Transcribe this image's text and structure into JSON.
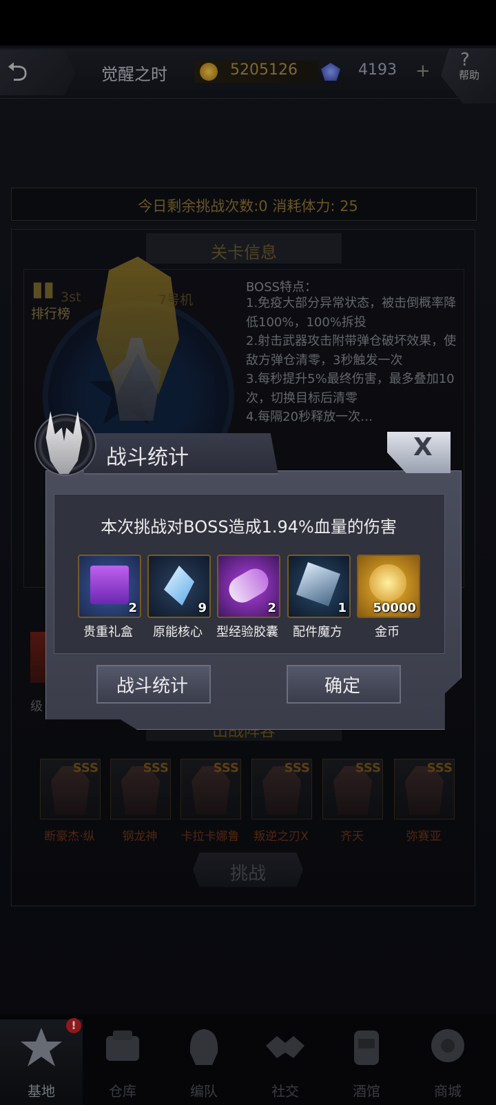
{
  "header": {
    "title": "觉醒之时",
    "coins": "5205126",
    "gems": "4193",
    "plus_label": "+",
    "help_label": "帮助",
    "help_symbol": "?"
  },
  "stage": {
    "attempts_text": "今日剩余挑战次数:0  消耗体力: 25",
    "panel_title": "关卡信息",
    "rank_label": "排行榜",
    "faint_left": "3st",
    "faint_right": "7号机",
    "boss_title": "BOSS特点：",
    "boss_features": [
      "1.免疫大部分异常状态，被击倒概率降低100%，100%拆投",
      "2.射击武器攻击附带弹仓破坏效果，使敌方弹仓清零，3秒触发一次",
      "3.每秒提升5%最终伤害，最多叠加10次，切换目标后清零",
      "4.每隔20秒释放一次…"
    ],
    "left_label": "级",
    "lineup_title": "出战阵容",
    "units": [
      {
        "name": "断豪杰·纵",
        "grade": "SSS"
      },
      {
        "name": "钢龙神",
        "grade": "SSS"
      },
      {
        "name": "卡拉卡娜鲁",
        "grade": "SSS"
      },
      {
        "name": "叛逆之刃X",
        "grade": "SSS"
      },
      {
        "name": "齐天",
        "grade": "SSS"
      },
      {
        "name": "弥赛亚",
        "grade": "SSS"
      }
    ],
    "challenge_label": "挑战"
  },
  "dialog": {
    "title": "战斗统计",
    "close_label": "X",
    "message": "本次挑战对BOSS造成1.94%血量的伤害",
    "rewards": [
      {
        "name": "贵重礼盒",
        "qty": "2",
        "color": "#7a3cc0"
      },
      {
        "name": "原能核心",
        "qty": "9",
        "color": "#2a5a8a"
      },
      {
        "name": "型经验胶囊",
        "qty": "2",
        "color": "#8a2ab0"
      },
      {
        "name": "配件魔方",
        "qty": "1",
        "color": "#2a4a6a"
      },
      {
        "name": "金币",
        "qty": "50000",
        "color": "#b08018"
      }
    ],
    "stats_button": "战斗统计",
    "confirm_button": "确定"
  },
  "nav": {
    "badge": "!",
    "items": [
      {
        "label": "基地",
        "icon": "base-icon"
      },
      {
        "label": "仓库",
        "icon": "warehouse-icon"
      },
      {
        "label": "编队",
        "icon": "formation-icon"
      },
      {
        "label": "社交",
        "icon": "social-icon"
      },
      {
        "label": "酒馆",
        "icon": "tavern-icon"
      },
      {
        "label": "商城",
        "icon": "shop-icon"
      }
    ]
  }
}
